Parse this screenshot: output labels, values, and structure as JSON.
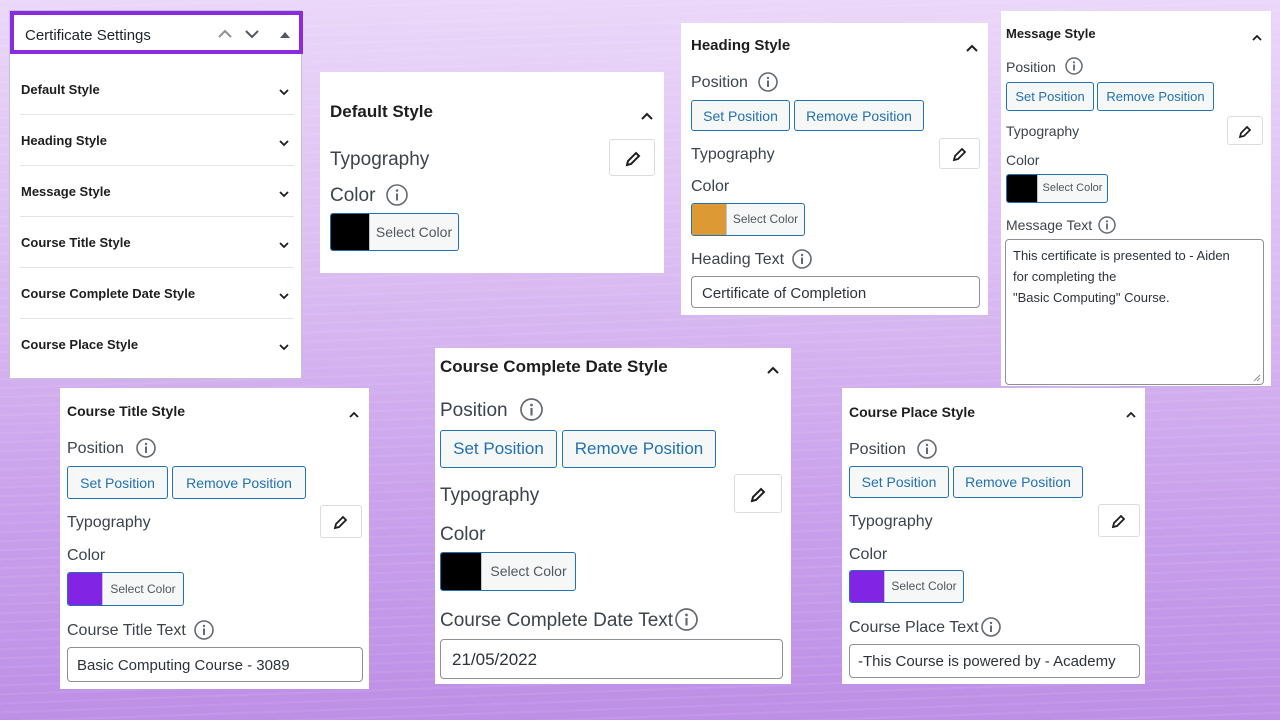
{
  "settings": {
    "title": "Certificate Settings",
    "items": [
      "Default Style",
      "Heading Style",
      "Message Style",
      "Course Title Style",
      "Course Complete Date Style",
      "Course Place Style"
    ]
  },
  "labels": {
    "position": "Position",
    "typography": "Typography",
    "color": "Color",
    "set_position": "Set Position",
    "remove_position": "Remove Position",
    "select_color": "Select Color"
  },
  "default_style": {
    "title": "Default Style",
    "color": "#000000"
  },
  "heading_style": {
    "title": "Heading Style",
    "color": "#dd9933",
    "text_label": "Heading Text",
    "text_value": "Certificate of Completion"
  },
  "message_style": {
    "title": "Message Style",
    "color": "#000000",
    "text_label": "Message Text",
    "line1": "This certificate is presented to - Aiden",
    "line2": "for completing the",
    "line3": "\"Basic Computing\" Course."
  },
  "course_title_style": {
    "title": "Course Title Style",
    "color": "#8224e3",
    "text_label": "Course Title Text",
    "text_value": "Basic Computing Course - 3089"
  },
  "course_date_style": {
    "title": "Course Complete Date Style",
    "color": "#000000",
    "text_label": "Course Complete Date Text",
    "text_value": "21/05/2022"
  },
  "course_place_style": {
    "title": "Course Place Style",
    "color": "#8224e3",
    "text_label": "Course Place Text",
    "text_value": "-This Course is powered by - Academy"
  },
  "icons": {
    "expand": "chevron-down-icon",
    "collapse": "chevron-up-icon",
    "info": "info-icon",
    "edit": "pencil-icon"
  }
}
